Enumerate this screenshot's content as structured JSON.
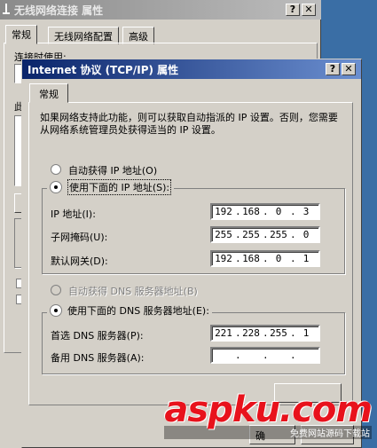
{
  "back_window": {
    "title": "无线网络连接 属性",
    "tabs": [
      "常规",
      "无线网络配置",
      "高级"
    ],
    "connect_using_label": "连接时使用:",
    "this_connection_label": "此"
  },
  "dialog": {
    "title": "Internet 协议 (TCP/IP) 属性",
    "help_btn": "?",
    "close_btn": "✕",
    "tab_general": "常规",
    "intro_text": "如果网络支持此功能，则可以获取自动指派的 IP 设置。否则，您需要从网络系统管理员处获得适当的 IP 设置。",
    "radio_auto_ip": "自动获得 IP 地址(O)",
    "radio_manual_ip": "使用下面的 IP 地址(S):",
    "ip_label": "IP 地址(I):",
    "ip_value": [
      "192",
      "168",
      "0",
      "3"
    ],
    "mask_label": "子网掩码(U):",
    "mask_value": [
      "255",
      "255",
      "255",
      "0"
    ],
    "gateway_label": "默认网关(D):",
    "gateway_value": [
      "192",
      "168",
      "0",
      "1"
    ],
    "radio_auto_dns": "自动获得 DNS 服务器地址(B)",
    "radio_manual_dns": "使用下面的 DNS 服务器地址(E):",
    "dns_primary_label": "首选 DNS 服务器(P):",
    "dns_primary_value": [
      "221",
      "228",
      "255",
      "1"
    ],
    "dns_alt_label": "备用 DNS 服务器(A):",
    "dns_alt_value": [
      "",
      "",
      "",
      ""
    ],
    "bottom_btn_partial": "确"
  },
  "watermark": {
    "main": "aspku.com",
    "sub": "免费网站源码下载站"
  },
  "colors": {
    "titlebar_active": "#0a246a",
    "face": "#d4d0c8",
    "watermark": "#e8121c"
  }
}
